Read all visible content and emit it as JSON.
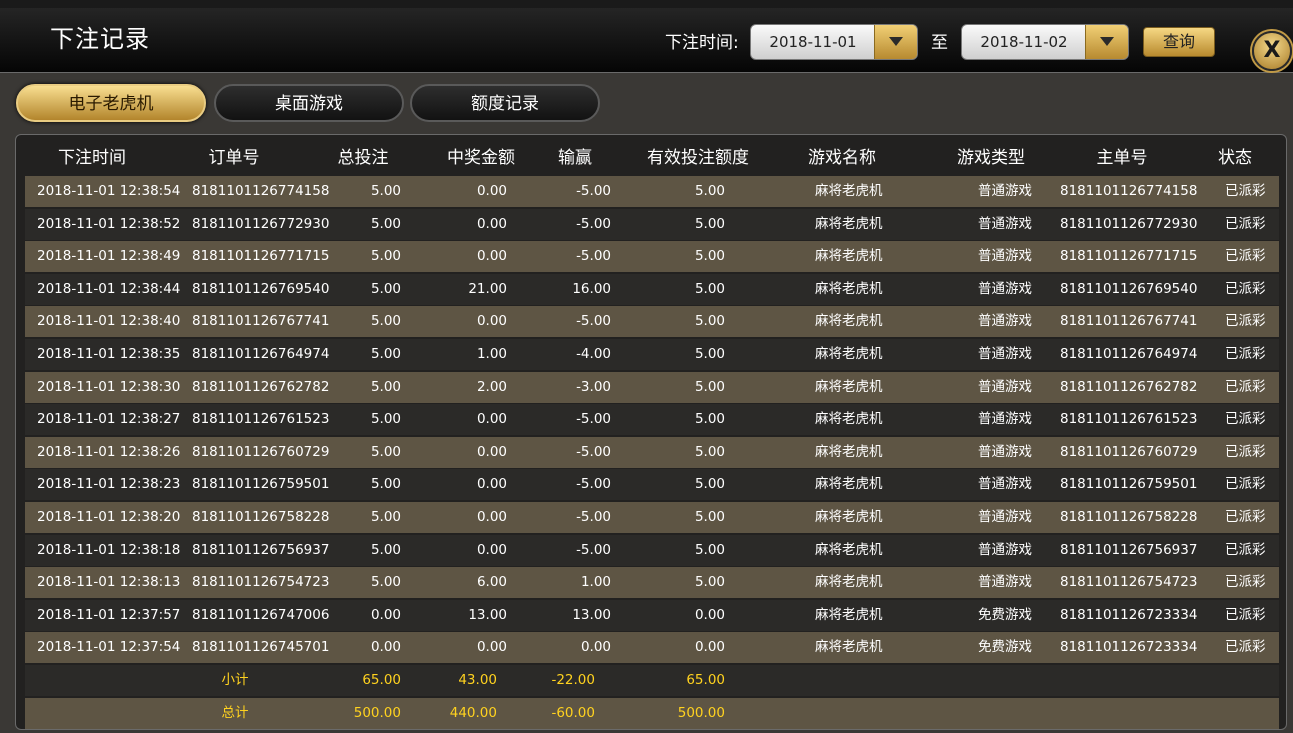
{
  "header": {
    "title": "下注记录",
    "time_label": "下注时间:",
    "start_date": "2018-11-01",
    "to_label": "至",
    "end_date": "2018-11-02",
    "query_label": "查询",
    "close_label": "X"
  },
  "tabs": [
    {
      "label": "电子老虎机",
      "active": true
    },
    {
      "label": "桌面游戏",
      "active": false
    },
    {
      "label": "额度记录",
      "active": false
    }
  ],
  "table": {
    "columns": [
      "下注时间",
      "订单号",
      "总投注",
      "中奖金额",
      "输赢",
      "有效投注额度",
      "游戏名称",
      "游戏类型",
      "主单号",
      "状态"
    ],
    "rows": [
      [
        "2018-11-01 12:38:54",
        "8181101126774158",
        "5.00",
        "0.00",
        "-5.00",
        "5.00",
        "麻将老虎机",
        "普通游戏",
        "8181101126774158",
        "已派彩"
      ],
      [
        "2018-11-01 12:38:52",
        "8181101126772930",
        "5.00",
        "0.00",
        "-5.00",
        "5.00",
        "麻将老虎机",
        "普通游戏",
        "8181101126772930",
        "已派彩"
      ],
      [
        "2018-11-01 12:38:49",
        "8181101126771715",
        "5.00",
        "0.00",
        "-5.00",
        "5.00",
        "麻将老虎机",
        "普通游戏",
        "8181101126771715",
        "已派彩"
      ],
      [
        "2018-11-01 12:38:44",
        "8181101126769540",
        "5.00",
        "21.00",
        "16.00",
        "5.00",
        "麻将老虎机",
        "普通游戏",
        "8181101126769540",
        "已派彩"
      ],
      [
        "2018-11-01 12:38:40",
        "8181101126767741",
        "5.00",
        "0.00",
        "-5.00",
        "5.00",
        "麻将老虎机",
        "普通游戏",
        "8181101126767741",
        "已派彩"
      ],
      [
        "2018-11-01 12:38:35",
        "8181101126764974",
        "5.00",
        "1.00",
        "-4.00",
        "5.00",
        "麻将老虎机",
        "普通游戏",
        "8181101126764974",
        "已派彩"
      ],
      [
        "2018-11-01 12:38:30",
        "8181101126762782",
        "5.00",
        "2.00",
        "-3.00",
        "5.00",
        "麻将老虎机",
        "普通游戏",
        "8181101126762782",
        "已派彩"
      ],
      [
        "2018-11-01 12:38:27",
        "8181101126761523",
        "5.00",
        "0.00",
        "-5.00",
        "5.00",
        "麻将老虎机",
        "普通游戏",
        "8181101126761523",
        "已派彩"
      ],
      [
        "2018-11-01 12:38:26",
        "8181101126760729",
        "5.00",
        "0.00",
        "-5.00",
        "5.00",
        "麻将老虎机",
        "普通游戏",
        "8181101126760729",
        "已派彩"
      ],
      [
        "2018-11-01 12:38:23",
        "8181101126759501",
        "5.00",
        "0.00",
        "-5.00",
        "5.00",
        "麻将老虎机",
        "普通游戏",
        "8181101126759501",
        "已派彩"
      ],
      [
        "2018-11-01 12:38:20",
        "8181101126758228",
        "5.00",
        "0.00",
        "-5.00",
        "5.00",
        "麻将老虎机",
        "普通游戏",
        "8181101126758228",
        "已派彩"
      ],
      [
        "2018-11-01 12:38:18",
        "8181101126756937",
        "5.00",
        "0.00",
        "-5.00",
        "5.00",
        "麻将老虎机",
        "普通游戏",
        "8181101126756937",
        "已派彩"
      ],
      [
        "2018-11-01 12:38:13",
        "8181101126754723",
        "5.00",
        "6.00",
        "1.00",
        "5.00",
        "麻将老虎机",
        "普通游戏",
        "8181101126754723",
        "已派彩"
      ],
      [
        "2018-11-01 12:37:57",
        "8181101126747006",
        "0.00",
        "13.00",
        "13.00",
        "0.00",
        "麻将老虎机",
        "免费游戏",
        "8181101126723334",
        "已派彩"
      ],
      [
        "2018-11-01 12:37:54",
        "8181101126745701",
        "0.00",
        "0.00",
        "0.00",
        "0.00",
        "麻将老虎机",
        "免费游戏",
        "8181101126723334",
        "已派彩"
      ]
    ],
    "subtotal": {
      "label": "小计",
      "total_bet": "65.00",
      "win_amount": "43.00",
      "profit": "-22.00",
      "valid_bet": "65.00"
    },
    "grand_total": {
      "label": "总计",
      "total_bet": "500.00",
      "win_amount": "440.00",
      "profit": "-60.00",
      "valid_bet": "500.00"
    }
  }
}
